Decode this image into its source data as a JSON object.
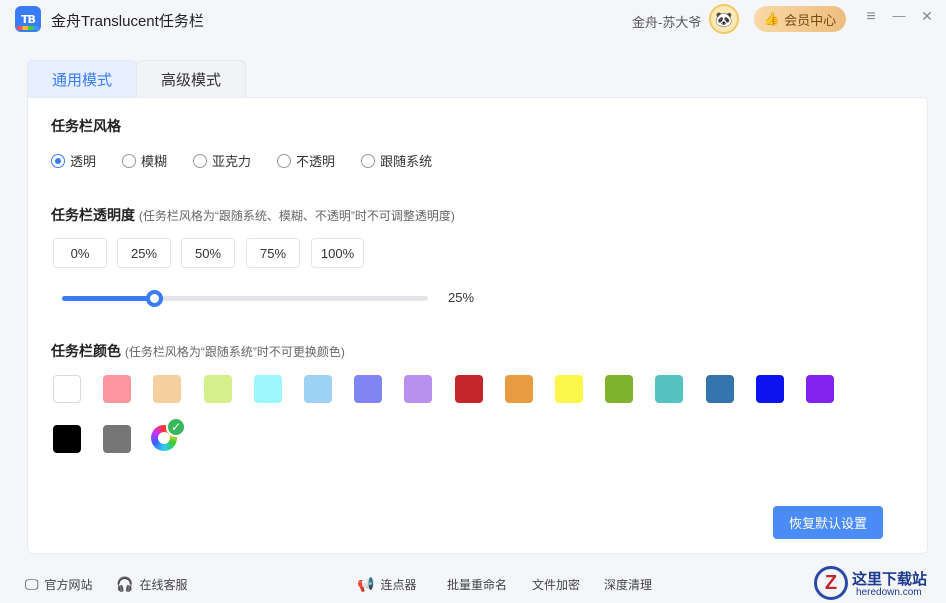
{
  "titlebar": {
    "logo_text": "TB",
    "title": "金舟Translucent任务栏",
    "user_name": "金舟-苏大爷",
    "vip_label": "会员中心",
    "menu_icon": "≡",
    "minimize_icon": "—",
    "close_icon": "✕"
  },
  "tabs": [
    {
      "label": "通用模式",
      "active": true
    },
    {
      "label": "高级模式",
      "active": false
    }
  ],
  "style_section": {
    "title": "任务栏风格",
    "options": [
      {
        "label": "透明",
        "checked": true
      },
      {
        "label": "模糊",
        "checked": false
      },
      {
        "label": "亚克力",
        "checked": false
      },
      {
        "label": "不透明",
        "checked": false
      },
      {
        "label": "跟随系统",
        "checked": false
      }
    ]
  },
  "opacity_section": {
    "title": "任务栏透明度",
    "note": "(任务栏风格为“跟随系统、模糊、不透明”时不可调整透明度)",
    "presets": [
      "0%",
      "25%",
      "50%",
      "75%",
      "100%"
    ],
    "slider_value": 25,
    "slider_label": "25%"
  },
  "color_section": {
    "title": "任务栏颜色",
    "note": "(任务栏风格为“跟随系统”时不可更换颜色)",
    "colors": [
      "#ffffff",
      "#fb95a0",
      "#f5d09e",
      "#d3f08a",
      "#9cf6fb",
      "#9ed2f5",
      "#8185f4",
      "#b98ff0",
      "#c5262a",
      "#e89c42",
      "#fbf84b",
      "#7fb22f",
      "#55c1c1",
      "#3475ae",
      "#0d13ee",
      "#8423ef",
      "#000000",
      "#767676"
    ],
    "custom_icon": "color-wheel-icon",
    "selected_check": "✓"
  },
  "reset_label": "恢复默认设置",
  "footer": {
    "left": [
      {
        "icon": "monitor-icon",
        "glyph": "🖵",
        "label": "官方网站"
      },
      {
        "icon": "headset-icon",
        "glyph": "🎧",
        "label": "在线客服"
      }
    ],
    "right": [
      {
        "icon": "megaphone-icon",
        "glyph": "📢",
        "label": "连点器"
      },
      {
        "icon": "",
        "glyph": "",
        "label": "批量重命名"
      },
      {
        "icon": "",
        "glyph": "",
        "label": "文件加密"
      },
      {
        "icon": "",
        "glyph": "",
        "label": "深度清理"
      }
    ]
  },
  "watermark": {
    "mark": "Z",
    "title": "这里下载站",
    "subtitle": "heredown.com"
  },
  "accent_color": "#3a7cf5"
}
